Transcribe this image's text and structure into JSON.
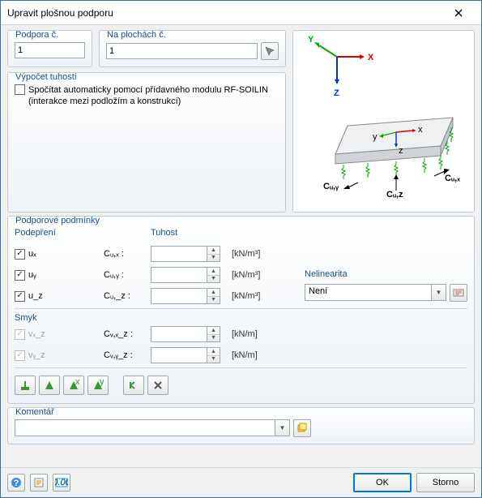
{
  "title": "Upravit plošnou podporu",
  "podpora": {
    "label": "Podpora č.",
    "value": "1"
  },
  "plochy": {
    "label": "Na plochách č.",
    "value": "1",
    "pick_hint": "Vybrat"
  },
  "tuhosti": {
    "legend": "Výpočet tuhostí",
    "auto_label": "Spočítat automaticky pomocí přídavného modulu RF-SOILIN (interakce mezi podložím a konstrukcí)",
    "auto_checked": false
  },
  "podminky": {
    "legend": "Podporové podmínky",
    "col_podepreni": "Podepření",
    "col_tuhost": "Tuhost",
    "rows": [
      {
        "chk": true,
        "chk_grey": false,
        "name": "uₓ",
        "sym": "Cᵤ,ₓ :",
        "val": "",
        "unit": "[kN/m³]"
      },
      {
        "chk": true,
        "chk_grey": false,
        "name": "uᵧ",
        "sym": "Cᵤ,ᵧ :",
        "val": "",
        "unit": "[kN/m³]"
      },
      {
        "chk": true,
        "chk_grey": false,
        "name": "u_z",
        "sym": "Cᵤ,_z :",
        "val": "",
        "unit": "[kN/m³]"
      }
    ],
    "smyk_label": "Smyk",
    "smyk_rows": [
      {
        "chk": true,
        "chk_grey": true,
        "name": "vₓ_z",
        "sym": "Cᵥ,ₓ_z :",
        "val": "",
        "unit": "[kN/m]"
      },
      {
        "chk": true,
        "chk_grey": true,
        "name": "vᵧ_z",
        "sym": "Cᵥ,ᵧ_z :",
        "val": "",
        "unit": "[kN/m]"
      }
    ],
    "nelinearita_label": "Nelinearita",
    "nelinearita_value": "Není"
  },
  "komentar": {
    "legend": "Komentář",
    "value": ""
  },
  "buttons": {
    "ok": "OK",
    "storno": "Storno"
  },
  "diagram": {
    "X": "X",
    "Y": "Y",
    "Z": "Z",
    "x": "x",
    "y": "y",
    "z": "z",
    "cux": "Cᵤ,ₓ",
    "cuy": "Cᵤ,ᵧ",
    "cuz": "Cᵤ,z"
  }
}
